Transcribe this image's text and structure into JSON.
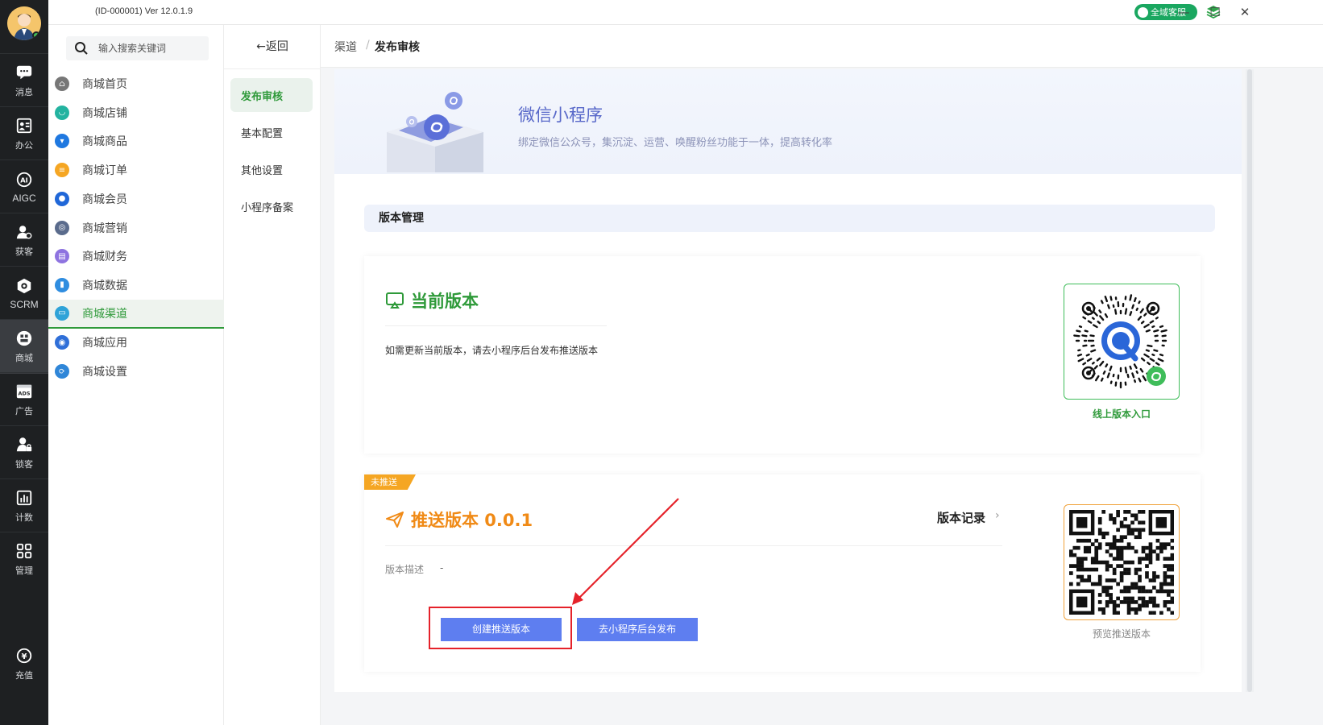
{
  "titlebar": {
    "app_version": "(ID-000001)  Ver 12.0.1.9",
    "service_label": "全域客服",
    "minimize": "—",
    "maximize": "☐",
    "close": "✕"
  },
  "rail": {
    "items": [
      {
        "label": "消息",
        "icon": "message-icon"
      },
      {
        "label": "办公",
        "icon": "office-icon"
      },
      {
        "label": "AIGC",
        "icon": "ai-icon"
      },
      {
        "label": "获客",
        "icon": "acquire-icon"
      },
      {
        "label": "SCRM",
        "icon": "scrm-icon"
      },
      {
        "label": "商城",
        "icon": "mall-icon"
      },
      {
        "label": "广告",
        "icon": "ads-icon"
      },
      {
        "label": "锁客",
        "icon": "lock-customer-icon"
      },
      {
        "label": "计数",
        "icon": "stats-icon"
      },
      {
        "label": "管理",
        "icon": "grid-icon"
      },
      {
        "label": "充值",
        "icon": "recharge-icon"
      }
    ]
  },
  "search": {
    "placeholder": "输入搜索关键词"
  },
  "menu": {
    "items": [
      {
        "label": "商城首页",
        "color": "#777777"
      },
      {
        "label": "商城店铺",
        "color": "#23b3a0"
      },
      {
        "label": "商城商品",
        "color": "#1f78e0"
      },
      {
        "label": "商城订单",
        "color": "#f5a623"
      },
      {
        "label": "商城会员",
        "color": "#2067d8"
      },
      {
        "label": "商城营销",
        "color": "#5a6b8c"
      },
      {
        "label": "商城财务",
        "color": "#8e73e0"
      },
      {
        "label": "商城数据",
        "color": "#2f8de0"
      },
      {
        "label": "商城渠道",
        "color": "#2fa3d8"
      },
      {
        "label": "商城应用",
        "color": "#2f6fd8"
      },
      {
        "label": "商城设置",
        "color": "#2f86d8"
      }
    ]
  },
  "subnav": {
    "back": "←返回",
    "items": [
      "发布审核",
      "基本配置",
      "其他设置",
      "小程序备案"
    ]
  },
  "breadcrumb": {
    "parent": "渠道",
    "sep": "/",
    "current": "发布审核"
  },
  "hero": {
    "title": "微信小程序",
    "desc": "绑定微信公众号，集沉淀、运营、唤醒粉丝功能于一体，提高转化率"
  },
  "section": {
    "title": "版本管理"
  },
  "current_version": {
    "title": "当前版本",
    "tip": "如需更新当前版本，请去小程序后台发布推送版本",
    "qr_caption": "线上版本入口"
  },
  "push_version": {
    "tag": "未推送",
    "title": "推送版本 0.0.1",
    "record": "版本记录",
    "record_arrow": "›",
    "desc_label": "版本描述",
    "desc_value": "-",
    "btn_create": "创建推送版本",
    "btn_goto": "去小程序后台发布",
    "qr_caption": "预览推送版本"
  },
  "colors": {
    "accent_green": "#2f9a3a",
    "accent_orange": "#f08a16",
    "button_blue": "#5e7ef0",
    "highlight_red": "#e5222a"
  }
}
